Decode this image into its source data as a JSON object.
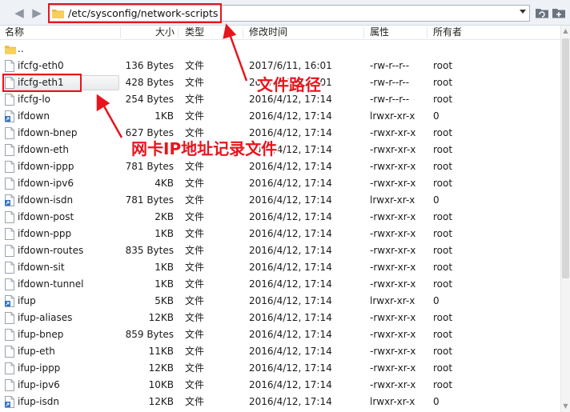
{
  "toolbar": {
    "back_icon": "back-arrow-icon",
    "forward_icon": "forward-arrow-icon",
    "path": "/etc/sysconfig/network-scripts",
    "folder_icon": "folder-icon",
    "dropdown_icon": "chevron-down-icon",
    "refresh_icon": "refresh-folder-icon",
    "add_icon": "add-folder-icon"
  },
  "columns": {
    "name": "名称",
    "size": "大小",
    "type": "类型",
    "modified": "修改时间",
    "attributes": "属性",
    "owner": "所有者"
  },
  "parent_dir": "..",
  "files": [
    {
      "name": "ifcfg-eth0",
      "size": "136 Bytes",
      "type": "文件",
      "modified": "2017/6/11, 16:01",
      "perm": "-rw-r--r--",
      "owner": "root",
      "icon": "file-icon"
    },
    {
      "name": "ifcfg-eth1",
      "size": "428 Bytes",
      "type": "文件",
      "modified": "2017/6/11, 16:01",
      "perm": "-rw-r--r--",
      "owner": "root",
      "icon": "file-icon"
    },
    {
      "name": "ifcfg-lo",
      "size": "254 Bytes",
      "type": "文件",
      "modified": "2016/4/12, 17:14",
      "perm": "-rw-r--r--",
      "owner": "root",
      "icon": "file-icon"
    },
    {
      "name": "ifdown",
      "size": "1KB",
      "type": "文件",
      "modified": "2016/4/12, 17:14",
      "perm": "lrwxr-xr-x",
      "owner": "0",
      "icon": "symlink-file-icon"
    },
    {
      "name": "ifdown-bnep",
      "size": "627 Bytes",
      "type": "文件",
      "modified": "2016/4/12, 17:14",
      "perm": "-rwxr-xr-x",
      "owner": "root",
      "icon": "file-icon"
    },
    {
      "name": "ifdown-eth",
      "size": "",
      "type": "文件",
      "modified": "2016/4/12, 17:14",
      "perm": "-rwxr-xr-x",
      "owner": "root",
      "icon": "file-icon"
    },
    {
      "name": "ifdown-ippp",
      "size": "781 Bytes",
      "type": "文件",
      "modified": "2016/4/12, 17:14",
      "perm": "-rwxr-xr-x",
      "owner": "root",
      "icon": "file-icon"
    },
    {
      "name": "ifdown-ipv6",
      "size": "4KB",
      "type": "文件",
      "modified": "2016/4/12, 17:14",
      "perm": "-rwxr-xr-x",
      "owner": "root",
      "icon": "file-icon"
    },
    {
      "name": "ifdown-isdn",
      "size": "781 Bytes",
      "type": "文件",
      "modified": "2016/4/12, 17:14",
      "perm": "lrwxr-xr-x",
      "owner": "0",
      "icon": "symlink-file-icon"
    },
    {
      "name": "ifdown-post",
      "size": "2KB",
      "type": "文件",
      "modified": "2016/4/12, 17:14",
      "perm": "-rwxr-xr-x",
      "owner": "root",
      "icon": "file-icon"
    },
    {
      "name": "ifdown-ppp",
      "size": "1KB",
      "type": "文件",
      "modified": "2016/4/12, 17:14",
      "perm": "-rwxr-xr-x",
      "owner": "root",
      "icon": "file-icon"
    },
    {
      "name": "ifdown-routes",
      "size": "835 Bytes",
      "type": "文件",
      "modified": "2016/4/12, 17:14",
      "perm": "-rwxr-xr-x",
      "owner": "root",
      "icon": "file-icon"
    },
    {
      "name": "ifdown-sit",
      "size": "1KB",
      "type": "文件",
      "modified": "2016/4/12, 17:14",
      "perm": "-rwxr-xr-x",
      "owner": "root",
      "icon": "file-icon"
    },
    {
      "name": "ifdown-tunnel",
      "size": "1KB",
      "type": "文件",
      "modified": "2016/4/12, 17:14",
      "perm": "-rwxr-xr-x",
      "owner": "root",
      "icon": "file-icon"
    },
    {
      "name": "ifup",
      "size": "5KB",
      "type": "文件",
      "modified": "2016/4/12, 17:14",
      "perm": "lrwxr-xr-x",
      "owner": "0",
      "icon": "symlink-file-icon"
    },
    {
      "name": "ifup-aliases",
      "size": "12KB",
      "type": "文件",
      "modified": "2016/4/12, 17:14",
      "perm": "-rwxr-xr-x",
      "owner": "root",
      "icon": "file-icon"
    },
    {
      "name": "ifup-bnep",
      "size": "859 Bytes",
      "type": "文件",
      "modified": "2016/4/12, 17:14",
      "perm": "-rwxr-xr-x",
      "owner": "root",
      "icon": "file-icon"
    },
    {
      "name": "ifup-eth",
      "size": "11KB",
      "type": "文件",
      "modified": "2016/4/12, 17:14",
      "perm": "-rwxr-xr-x",
      "owner": "root",
      "icon": "file-icon"
    },
    {
      "name": "ifup-ippp",
      "size": "12KB",
      "type": "文件",
      "modified": "2016/4/12, 17:14",
      "perm": "-rwxr-xr-x",
      "owner": "root",
      "icon": "file-icon"
    },
    {
      "name": "ifup-ipv6",
      "size": "10KB",
      "type": "文件",
      "modified": "2016/4/12, 17:14",
      "perm": "-rwxr-xr-x",
      "owner": "root",
      "icon": "file-icon"
    },
    {
      "name": "ifup-isdn",
      "size": "12KB",
      "type": "文件",
      "modified": "2016/4/12, 17:14",
      "perm": "lrwxr-xr-x",
      "owner": "0",
      "icon": "symlink-file-icon"
    }
  ],
  "annotations": {
    "path_label": "文件路径",
    "ip_file_label": "网卡IP地址记录文件",
    "color": "#e8141c"
  }
}
